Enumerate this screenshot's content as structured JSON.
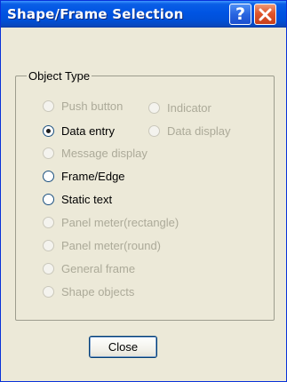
{
  "window": {
    "title": "Shape/Frame Selection",
    "help_glyph": "?",
    "help_icon": "question-mark-icon",
    "close_icon": "close-x-icon"
  },
  "group": {
    "title": "Object Type"
  },
  "options": [
    {
      "label": "Push button",
      "enabled": false,
      "checked": false
    },
    {
      "label": "Indicator",
      "enabled": false,
      "checked": false
    },
    {
      "label": "Data entry",
      "enabled": true,
      "checked": true
    },
    {
      "label": "Data display",
      "enabled": false,
      "checked": false
    },
    {
      "label": "Message display",
      "enabled": false,
      "checked": false
    },
    {
      "label": "Frame/Edge",
      "enabled": true,
      "checked": false
    },
    {
      "label": "Static text",
      "enabled": true,
      "checked": false
    },
    {
      "label": "Panel meter(rectangle)",
      "enabled": false,
      "checked": false
    },
    {
      "label": "Panel meter(round)",
      "enabled": false,
      "checked": false
    },
    {
      "label": "General frame",
      "enabled": false,
      "checked": false
    },
    {
      "label": "Shape objects",
      "enabled": false,
      "checked": false
    }
  ],
  "buttons": {
    "close_label": "Close"
  },
  "colors": {
    "titlebar": "#0054e3",
    "dialog_bg": "#ece9d8",
    "disabled_text": "#acaa99",
    "close_x": "#e0552c"
  }
}
